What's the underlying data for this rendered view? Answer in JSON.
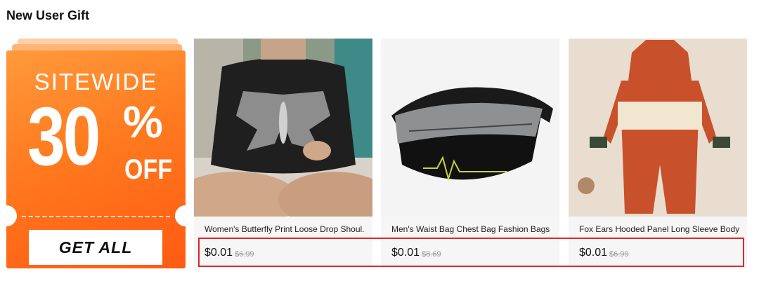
{
  "section": {
    "title": "New User Gift"
  },
  "coupon": {
    "line1": "SITEWIDE",
    "number": "30",
    "percent": "%",
    "off": "OFF",
    "button_label": "GET ALL"
  },
  "products": [
    {
      "title": "Women's Butterfly Print Loose Drop Shoul...",
      "price": "$0.01",
      "original_price": "$6.99"
    },
    {
      "title": "Men's Waist Bag Chest Bag Fashion Bags C...",
      "price": "$0.01",
      "original_price": "$8.69"
    },
    {
      "title": "Fox Ears Hooded Panel Long Sleeve Bodys...",
      "price": "$0.01",
      "original_price": "$6.99"
    }
  ],
  "colors": {
    "coupon_orange": "#ff7a1f",
    "highlight_red": "#e0262b"
  }
}
